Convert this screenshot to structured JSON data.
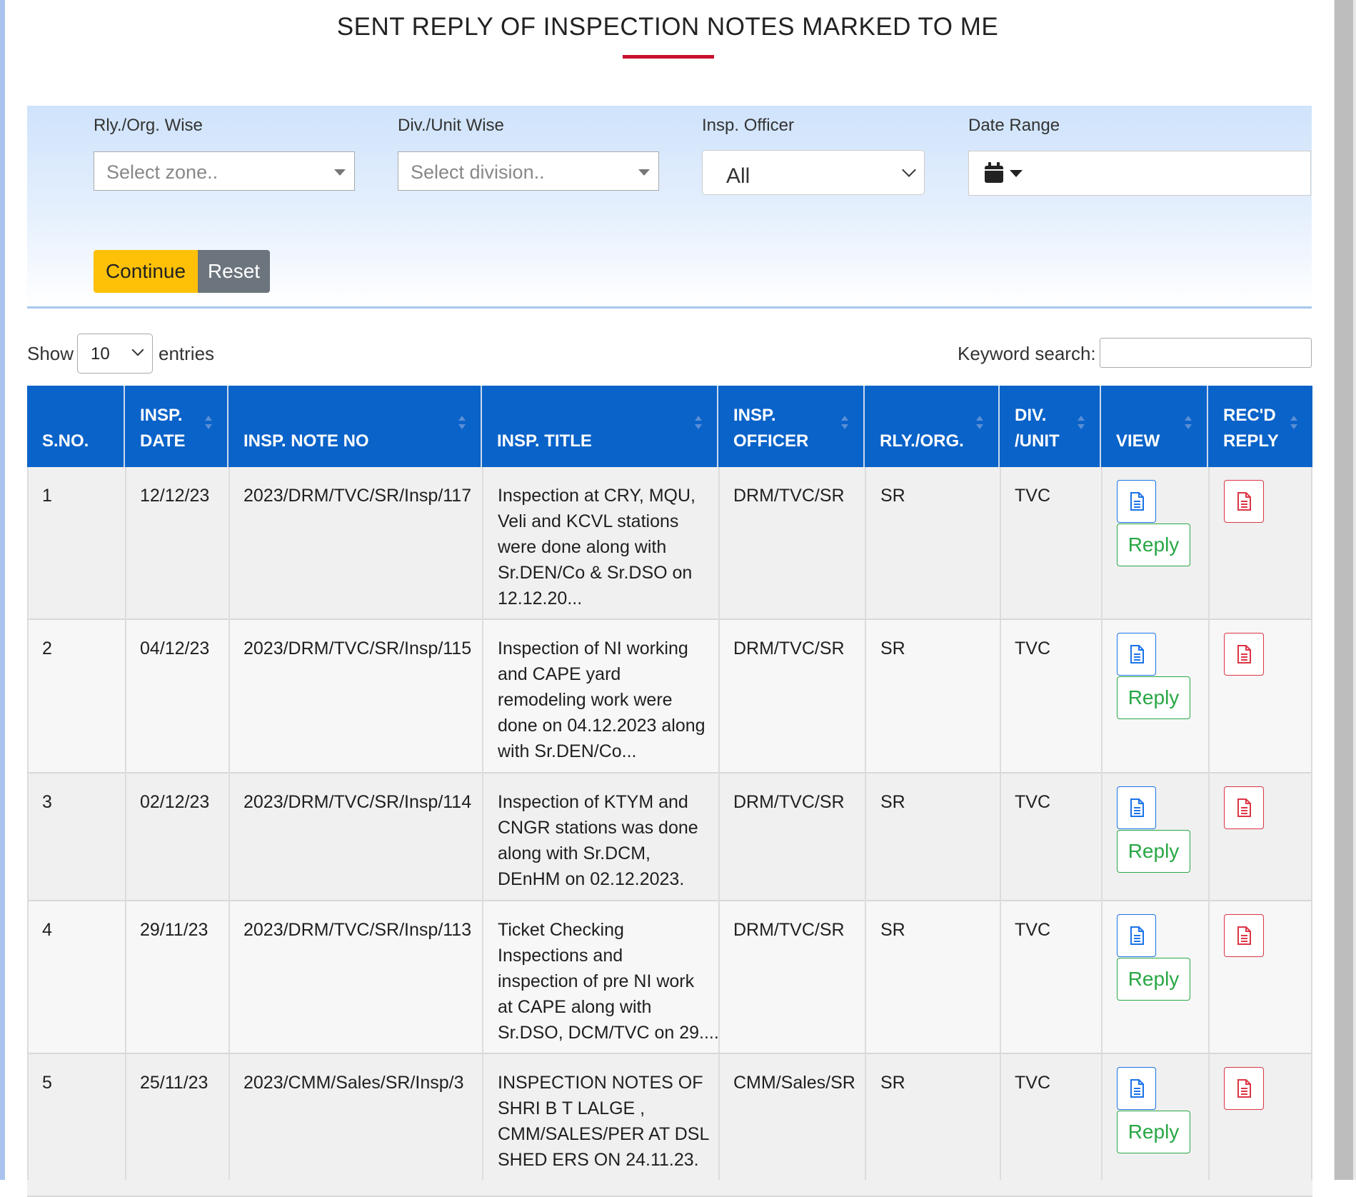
{
  "page": {
    "title": "SENT REPLY OF INSPECTION NOTES MARKED TO ME"
  },
  "filters": {
    "zone": {
      "label": "Rly./Org. Wise",
      "placeholder": "Select zone.."
    },
    "division": {
      "label": "Div./Unit Wise",
      "placeholder": "Select division.."
    },
    "officer": {
      "label": "Insp. Officer",
      "value": "All"
    },
    "date_range": {
      "label": "Date Range",
      "icon": "calendar-icon"
    },
    "continue_label": "Continue",
    "reset_label": "Reset"
  },
  "table_controls": {
    "show_label": "Show",
    "entries_value": "10",
    "entries_label": "entries",
    "search_label": "Keyword search:"
  },
  "table": {
    "headers": [
      [
        "S.NO."
      ],
      [
        "INSP.",
        "DATE"
      ],
      [
        "INSP. NOTE NO"
      ],
      [
        "INSP. TITLE"
      ],
      [
        "INSP.",
        "OFFICER"
      ],
      [
        "RLY./ORG."
      ],
      [
        "DIV.",
        "/UNIT"
      ],
      [
        "VIEW"
      ],
      [
        "REC'D",
        "REPLY"
      ]
    ],
    "reply_label": "Reply",
    "rows": [
      {
        "sno": "1",
        "date": "12/12/23",
        "note_no": "2023/DRM/TVC/SR/Insp/117",
        "title": [
          "Inspection at CRY, MQU,",
          "Veli and KCVL stations",
          "were done along with",
          "Sr.DEN/Co & Sr.DSO on",
          "12.12.20..."
        ],
        "officer": "DRM/TVC/SR",
        "rly": "SR",
        "div": "TVC"
      },
      {
        "sno": "2",
        "date": "04/12/23",
        "note_no": "2023/DRM/TVC/SR/Insp/115",
        "title": [
          "Inspection of NI working",
          "and CAPE yard",
          "remodeling work were",
          "done on 04.12.2023 along",
          "with Sr.DEN/Co..."
        ],
        "officer": "DRM/TVC/SR",
        "rly": "SR",
        "div": "TVC"
      },
      {
        "sno": "3",
        "date": "02/12/23",
        "note_no": "2023/DRM/TVC/SR/Insp/114",
        "title": [
          "Inspection of KTYM and",
          "CNGR stations was done",
          "along with Sr.DCM,",
          "DEnHM on 02.12.2023."
        ],
        "officer": "DRM/TVC/SR",
        "rly": "SR",
        "div": "TVC"
      },
      {
        "sno": "4",
        "date": "29/11/23",
        "note_no": "2023/DRM/TVC/SR/Insp/113",
        "title": [
          "Ticket Checking",
          "Inspections and",
          "inspection of pre NI work",
          "at CAPE along with",
          "Sr.DSO, DCM/TVC on 29...."
        ],
        "officer": "DRM/TVC/SR",
        "rly": "SR",
        "div": "TVC"
      },
      {
        "sno": "5",
        "date": "25/11/23",
        "note_no": "2023/CMM/Sales/SR/Insp/3",
        "title": [
          "INSPECTION NOTES OF",
          "SHRI B T LALGE ,",
          "CMM/SALES/PER AT DSL",
          "SHED ERS ON 24.11.23."
        ],
        "officer": "CMM/Sales/SR",
        "rly": "SR",
        "div": "TVC"
      }
    ]
  },
  "colors": {
    "header_bg": "#0a63c9",
    "title_underline": "#c8102e",
    "continue_bg": "#ffc107",
    "reset_bg": "#6c757d",
    "view_border": "#1a73e8",
    "reply_color": "#28a745",
    "recd_color": "#dc3545"
  },
  "icons": {
    "view": "file-text-icon",
    "recd_reply": "file-pdf-icon",
    "calendar": "calendar-icon"
  }
}
